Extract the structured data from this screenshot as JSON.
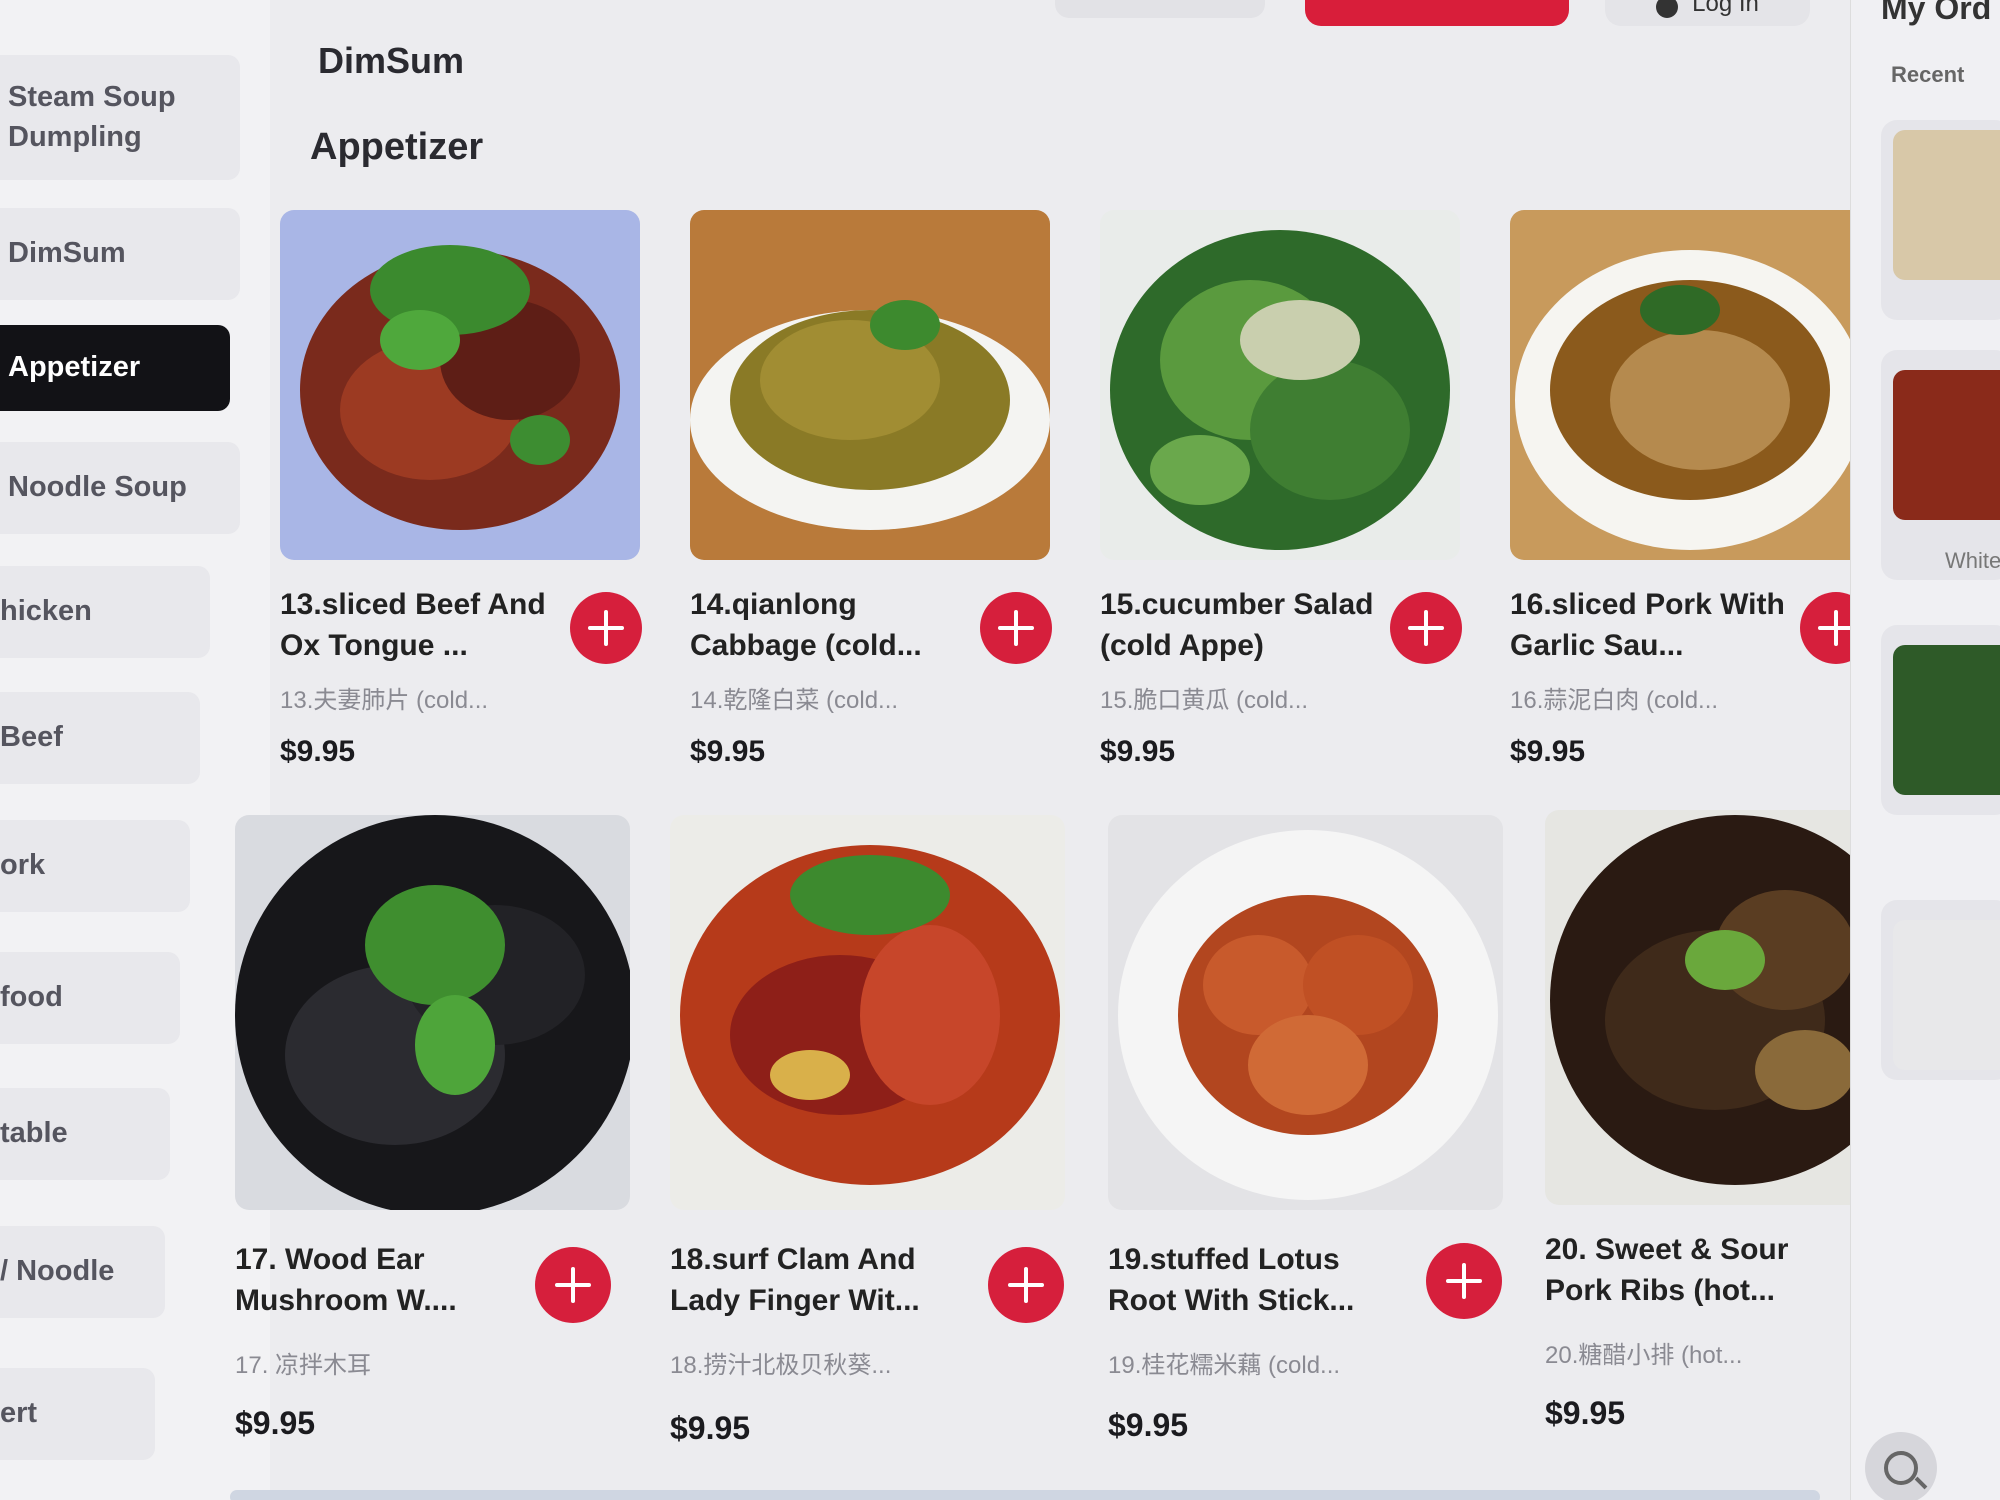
{
  "header": {
    "login_label": "Log In",
    "orders_title": "My Ord",
    "recent_label": "Recent"
  },
  "sidebar": {
    "items": [
      {
        "label": "Steam Soup\nDumpling",
        "active": false
      },
      {
        "label": "DimSum",
        "active": false
      },
      {
        "label": "Appetizer",
        "active": true
      },
      {
        "label": "Noodle Soup",
        "active": false
      },
      {
        "label": "hicken",
        "active": false
      },
      {
        "label": "Beef",
        "active": false
      },
      {
        "label": "ork",
        "active": false
      },
      {
        "label": "food",
        "active": false
      },
      {
        "label": "table",
        "active": false
      },
      {
        "label": "/ Noodle",
        "active": false
      },
      {
        "label": "ert",
        "active": false
      }
    ]
  },
  "main": {
    "prev_section_title": "DimSum",
    "section_title": "Appetizer",
    "items": [
      {
        "name": "13.sliced Beef And Ox Tongue ...",
        "sub": "13.夫妻肺片 (cold...",
        "price": "$9.95",
        "image": "beef-ox-tongue-photo"
      },
      {
        "name": "14.qianlong Cabbage (cold...",
        "sub": "14.乾隆白菜 (cold...",
        "price": "$9.95",
        "image": "qianlong-cabbage-photo"
      },
      {
        "name": "15.cucumber Salad (cold Appe)",
        "sub": "15.脆口黄瓜 (cold...",
        "price": "$9.95",
        "image": "cucumber-salad-photo"
      },
      {
        "name": "16.sliced Pork With Garlic Sau...",
        "sub": "16.蒜泥白肉 (cold...",
        "price": "$9.95",
        "image": "sliced-pork-garlic-photo"
      },
      {
        "name": "17. Wood Ear Mushroom W....",
        "sub": "17. 凉拌木耳",
        "price": "$9.95",
        "image": "wood-ear-mushroom-photo"
      },
      {
        "name": "18.surf Clam And Lady Finger Wit...",
        "sub": "18.捞汁北极贝秋葵...",
        "price": "$9.95",
        "image": "surf-clam-photo"
      },
      {
        "name": "19.stuffed Lotus Root With Stick...",
        "sub": "19.桂花糯米藕 (cold...",
        "price": "$9.95",
        "image": "stuffed-lotus-root-photo"
      },
      {
        "name": "20. Sweet & Sour Pork Ribs (hot...",
        "sub": "20.糖醋小排 (hot...",
        "price": "$9.95",
        "image": "sweet-sour-ribs-photo"
      }
    ]
  },
  "right_panel": {
    "recent_item_label": "White"
  },
  "colors": {
    "accent": "#d61f3c",
    "active_category": "#121216",
    "background": "#ececef"
  }
}
